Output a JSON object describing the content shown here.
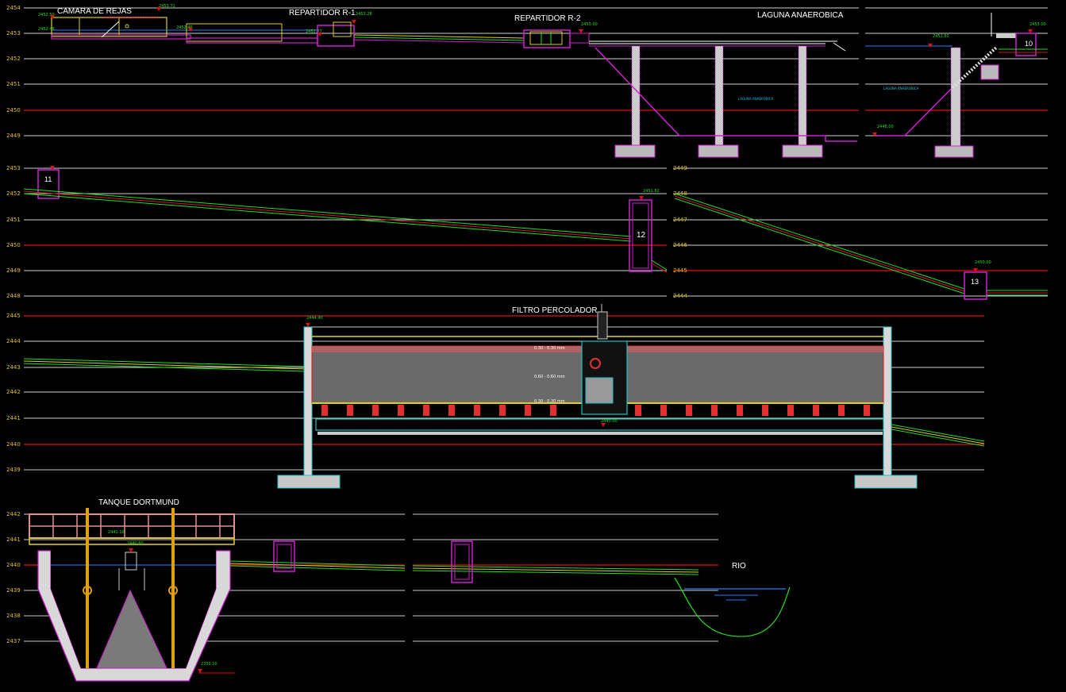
{
  "titles": {
    "camara": "CAMARA DE REJAS",
    "repartidor1": "REPARTIDOR R-1",
    "repartidor2": "REPARTIDOR R-2",
    "laguna": "LAGUNA  ANAEROBICA",
    "filtro": "FILTRO PERCOLADOR",
    "tanque": "TANQUE DORTMUND",
    "rio": "RIO"
  },
  "manholes": {
    "m10": "10",
    "m11": "11",
    "m12": "12",
    "m13": "13"
  },
  "levels": {
    "p1": [
      "2454",
      "2453",
      "2452",
      "2451",
      "2450",
      "2449"
    ],
    "p2": [
      "2453",
      "2452",
      "2451",
      "2450",
      "2449",
      "2448"
    ],
    "p3": [
      "2449",
      "2448",
      "2447",
      "2446",
      "2445",
      "2444"
    ],
    "p4": [
      "2445",
      "2444",
      "2443",
      "2442",
      "2441",
      "2440",
      "2439"
    ],
    "p5": [
      "2442",
      "2441",
      "2440",
      "2439",
      "2438",
      "2437"
    ]
  },
  "elevations": {
    "e1": "2453.71",
    "e2": "2452.50",
    "e3": "2452.48",
    "e4": "2453.28",
    "e5": "2452.77",
    "e6": "2452.46",
    "e7": "2453.00",
    "e8": "2452.50",
    "e9": "2448.00",
    "e10": "2453.00",
    "e11": "2451.82",
    "e12": "2450.00",
    "e13": "2444.40",
    "e14": "2440.00",
    "e15": "2441.10",
    "e16": "2440.60",
    "e17": "2350.10"
  },
  "inner": {
    "laguna_label": "LAGUNA ANAEROBICA",
    "filtro_layers": [
      "0.30 - 0.30 mm",
      "0.60 - 0.60 mm",
      "0.30 - 0.30 mm"
    ]
  }
}
